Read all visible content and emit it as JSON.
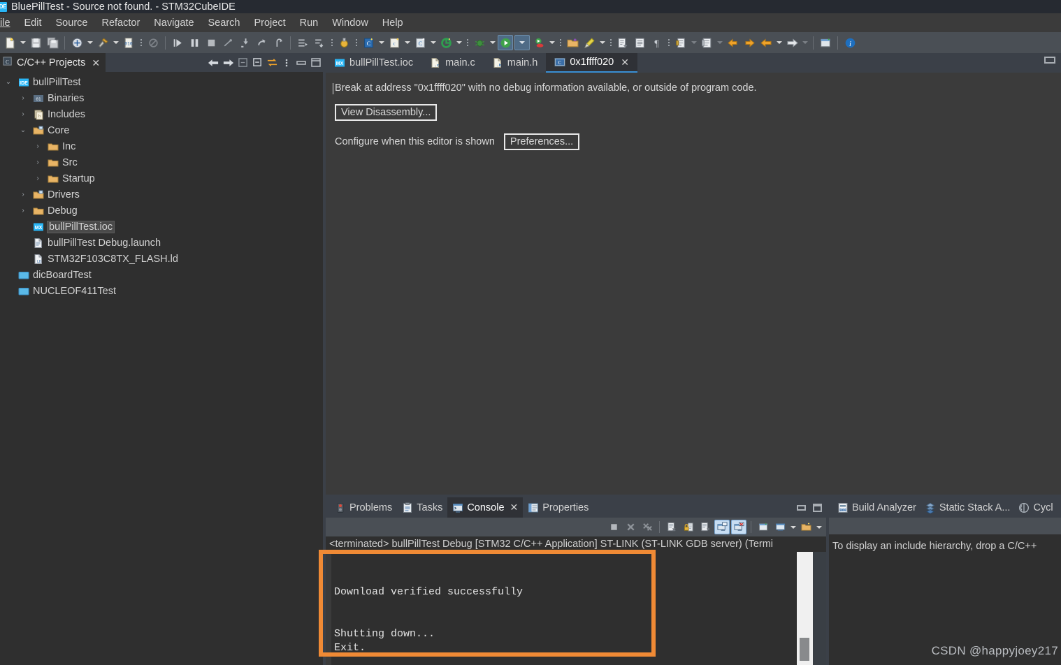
{
  "window": {
    "title": "BluePillTest - Source not found. - STM32CubeIDE",
    "app_icon": "ide-icon",
    "icon_text": "IDE"
  },
  "menubar": {
    "items": [
      {
        "label": "ile",
        "name": "menu-file"
      },
      {
        "label": "Edit",
        "name": "menu-edit"
      },
      {
        "label": "Source",
        "name": "menu-source"
      },
      {
        "label": "Refactor",
        "name": "menu-refactor"
      },
      {
        "label": "Navigate",
        "name": "menu-navigate"
      },
      {
        "label": "Search",
        "name": "menu-search"
      },
      {
        "label": "Project",
        "name": "menu-project"
      },
      {
        "label": "Run",
        "name": "menu-run"
      },
      {
        "label": "Window",
        "name": "menu-window"
      },
      {
        "label": "Help",
        "name": "menu-help"
      }
    ]
  },
  "toolbar": {
    "buttons": [
      "new-file-icon",
      "save-icon",
      "save-all-icon",
      "build-all-icon",
      "build-hammer-icon",
      "toggle-binary-icon",
      "skip-breakpoints-icon",
      "step-into-run-icon",
      "pause-icon",
      "stop-icon",
      "disconnect-icon",
      "step-into-icon",
      "step-over-icon",
      "step-return-icon",
      "next-edit-icon",
      "last-edit-icon",
      "debug-config-icon",
      "new-c-project-icon",
      "new-cpp-project-icon",
      "new-cube-project-icon",
      "debug-icon",
      "run-icon",
      "run-last-icon",
      "open-folder-icon",
      "marker-icon",
      "next-annotation-icon",
      "show-whitespace-icon",
      "pilcrow-icon",
      "block-selection-icon",
      "toggle-mark-icon",
      "back-icon",
      "forward-icon",
      "back-nav-icon",
      "forward-nav-icon",
      "open-perspective-icon",
      "info-icon"
    ]
  },
  "project_explorer": {
    "tab_label": "C/C++ Projects",
    "tab_icon": "cpp-projects-icon",
    "close_icon": "close-icon",
    "tools": [
      "back-icon",
      "forward-icon",
      "collapse-icon",
      "collapse-all-icon",
      "link-editor-icon",
      "view-menu-icon",
      "minimize-icon",
      "maximize-icon"
    ],
    "tree": [
      {
        "label": "bullPillTest",
        "depth": 0,
        "twist": "v",
        "icon": "ide-project-icon",
        "selected": false
      },
      {
        "label": "Binaries",
        "depth": 1,
        "twist": ">",
        "icon": "binaries-icon",
        "selected": false
      },
      {
        "label": "Includes",
        "depth": 1,
        "twist": ">",
        "icon": "includes-icon",
        "selected": false
      },
      {
        "label": "Core",
        "depth": 1,
        "twist": "v",
        "icon": "src-folder-icon",
        "selected": false
      },
      {
        "label": "Inc",
        "depth": 2,
        "twist": ">",
        "icon": "folder-icon",
        "selected": false
      },
      {
        "label": "Src",
        "depth": 2,
        "twist": ">",
        "icon": "folder-icon",
        "selected": false
      },
      {
        "label": "Startup",
        "depth": 2,
        "twist": ">",
        "icon": "folder-icon",
        "selected": false
      },
      {
        "label": "Drivers",
        "depth": 1,
        "twist": ">",
        "icon": "src-folder-icon",
        "selected": false
      },
      {
        "label": "Debug",
        "depth": 1,
        "twist": ">",
        "icon": "folder-icon",
        "selected": false
      },
      {
        "label": "bullPillTest.ioc",
        "depth": 1,
        "twist": "",
        "icon": "ioc-file-icon",
        "selected": true
      },
      {
        "label": "bullPillTest Debug.launch",
        "depth": 1,
        "twist": "",
        "icon": "launch-file-icon",
        "selected": false
      },
      {
        "label": "STM32F103C8TX_FLASH.ld",
        "depth": 1,
        "twist": "",
        "icon": "ld-file-icon",
        "selected": false
      },
      {
        "label": "dicBoardTest",
        "depth": 0,
        "twist": "",
        "icon": "closed-project-icon",
        "selected": false
      },
      {
        "label": "NUCLEOF411Test",
        "depth": 0,
        "twist": "",
        "icon": "closed-project-icon",
        "selected": false
      }
    ]
  },
  "editor": {
    "tabs": [
      {
        "label": "bullPillTest.ioc",
        "icon": "ioc-file-icon",
        "active": false,
        "closable": false
      },
      {
        "label": "main.c",
        "icon": "c-file-icon",
        "active": false,
        "closable": false
      },
      {
        "label": "main.h",
        "icon": "h-file-icon",
        "active": false,
        "closable": false
      },
      {
        "label": "0x1ffff020",
        "icon": "source-not-found-icon",
        "active": true,
        "closable": true
      }
    ],
    "close_icon": "close-icon",
    "maximize_icon": "maximize-icon",
    "message": "Break at address \"0x1ffff020\" with no debug information available, or outside of program code.",
    "view_disassembly_label": "View Disassembly...",
    "configure_label": "Configure when this editor is shown",
    "preferences_label": "Preferences..."
  },
  "console_panel": {
    "tabs": [
      {
        "label": "Problems",
        "icon": "problems-icon",
        "active": false,
        "closable": false
      },
      {
        "label": "Tasks",
        "icon": "tasks-icon",
        "active": false,
        "closable": false
      },
      {
        "label": "Console",
        "icon": "console-icon",
        "active": true,
        "closable": true
      },
      {
        "label": "Properties",
        "icon": "properties-icon",
        "active": false,
        "closable": false
      }
    ],
    "close_icon": "close-icon",
    "minimize_icon": "minimize-icon",
    "maximize_icon": "maximize-icon",
    "toolbar": [
      {
        "name": "terminate-icon",
        "selected": false
      },
      {
        "name": "remove-launch-icon",
        "selected": false
      },
      {
        "name": "remove-all-terminated-icon",
        "selected": false
      },
      {
        "name": "clear-console-icon",
        "selected": false
      },
      {
        "name": "scroll-lock-icon",
        "selected": false
      },
      {
        "name": "word-wrap-icon",
        "selected": false
      },
      {
        "name": "show-console-on-output-icon",
        "selected": true
      },
      {
        "name": "show-console-on-error-icon",
        "selected": true
      },
      {
        "name": "pin-console-icon",
        "selected": false
      },
      {
        "name": "display-selected-console-icon",
        "selected": false
      },
      {
        "name": "open-console-icon",
        "selected": false
      }
    ],
    "header_line": "<terminated> bullPillTest Debug [STM32 C/C++ Application] ST-LINK (ST-LINK GDB server) (Termi",
    "output": "Download verified successfully\n\n\nShutting down...\nExit.",
    "annotation_color": "#f08a35"
  },
  "right_panel": {
    "tabs": [
      {
        "label": "Build Analyzer",
        "icon": "build-analyzer-icon"
      },
      {
        "label": "Static Stack A...",
        "icon": "static-stack-icon"
      },
      {
        "label": "Cycl",
        "icon": "cyclomatic-icon"
      }
    ],
    "message": "To display an include hierarchy, drop a C/C++"
  },
  "watermark": {
    "text": "CSDN @happyjoey217"
  },
  "colors": {
    "titlebar_bg": "#262a31",
    "menubar_bg": "#3b3b3b",
    "toolbar_bg": "#4a4f55",
    "panel_bg": "#2f2f2f",
    "tab_strip_bg": "#3b4048",
    "active_tab_underline": "#3a8fd4",
    "text": "#d2d2d2",
    "annotation": "#f08a35",
    "folder": "#e8b465",
    "selected_toolbtn": "#c7ddf2"
  }
}
